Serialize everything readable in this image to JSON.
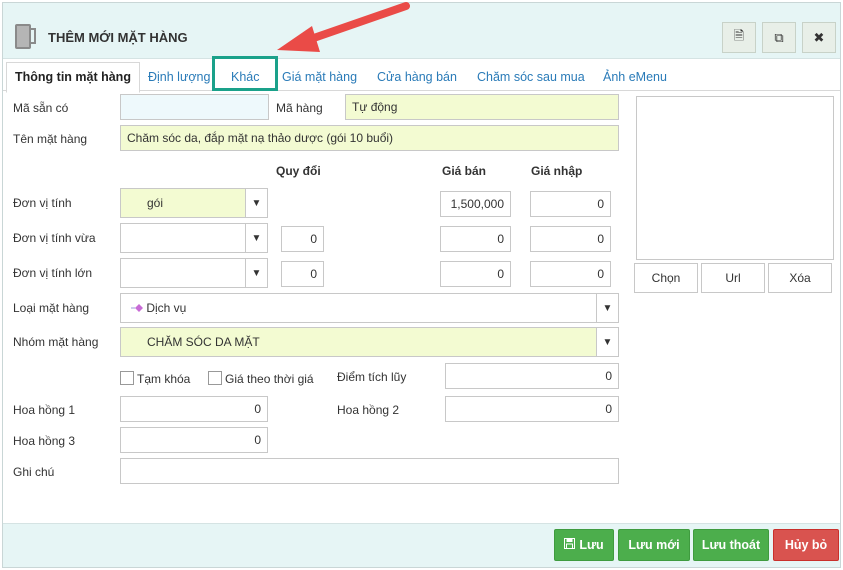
{
  "window": {
    "title": "THÊM MỚI MẶT HÀNG",
    "header_buttons": [
      {
        "icon": "document-icon",
        "glyph": "🗎"
      },
      {
        "icon": "copy-icon",
        "glyph": "⧉"
      },
      {
        "icon": "close-icon",
        "glyph": "✖"
      }
    ]
  },
  "tabs": [
    {
      "label": "Thông tin mặt hàng",
      "active": true
    },
    {
      "label": "Định lượng"
    },
    {
      "label": "Khác"
    },
    {
      "label": "Giá mặt hàng"
    },
    {
      "label": "Cửa hàng bán"
    },
    {
      "label": "Chăm sóc sau mua"
    },
    {
      "label": "Ảnh eMenu"
    }
  ],
  "form": {
    "ma_san_co": {
      "label": "Mã sẵn có",
      "value": ""
    },
    "ma_hang": {
      "label": "Mã hàng",
      "value": "Tự động"
    },
    "ten_mat_hang": {
      "label": "Tên mặt hàng",
      "value": "Chăm sóc da, đắp mặt nạ thảo dược (gói 10 buổi)"
    },
    "headers": {
      "quy_doi": "Quy đổi",
      "gia_ban": "Giá bán",
      "gia_nhap": "Giá nhập"
    },
    "don_vi_tinh": {
      "label": "Đơn vị tính",
      "value": "gói",
      "gia_ban": "1,500,000",
      "gia_nhap": "0"
    },
    "don_vi_tinh_vua": {
      "label": "Đơn vị tính vừa",
      "value": "",
      "quy_doi": "0",
      "gia_ban": "0",
      "gia_nhap": "0"
    },
    "don_vi_tinh_lon": {
      "label": "Đơn vị tính lớn",
      "value": "",
      "quy_doi": "0",
      "gia_ban": "0",
      "gia_nhap": "0"
    },
    "loai_mat_hang": {
      "label": "Loại mặt hàng",
      "value": "Dịch vụ"
    },
    "nhom_mat_hang": {
      "label": "Nhóm mặt hàng",
      "value": "CHĂM SÓC DA MẶT"
    },
    "tam_khoa": {
      "label": "Tạm khóa",
      "checked": false
    },
    "gia_theo_thoi_gia": {
      "label": "Giá theo thời giá",
      "checked": false
    },
    "diem_tich_luy": {
      "label": "Điểm tích lũy",
      "value": "0"
    },
    "hoa_hong_1": {
      "label": "Hoa hồng 1",
      "value": "0"
    },
    "hoa_hong_2": {
      "label": "Hoa hồng 2",
      "value": "0"
    },
    "hoa_hong_3": {
      "label": "Hoa hồng 3",
      "value": "0"
    },
    "ghi_chu": {
      "label": "Ghi chú",
      "value": ""
    }
  },
  "image_panel": {
    "choose_label": "Chọn",
    "url_label": "Url",
    "delete_label": "Xóa"
  },
  "footer": {
    "save_label": "Lưu",
    "save_new_label": "Lưu mới",
    "save_exit_label": "Lưu thoát",
    "cancel_label": "Hủy bỏ"
  },
  "colors": {
    "accent_green": "#4cae4c",
    "danger_red": "#d9534f",
    "title_bg": "#e6f5f5",
    "highlight_teal": "#1aa18a",
    "annotation_arrow": "#ea4b47",
    "link_blue": "#2a7bb8"
  }
}
